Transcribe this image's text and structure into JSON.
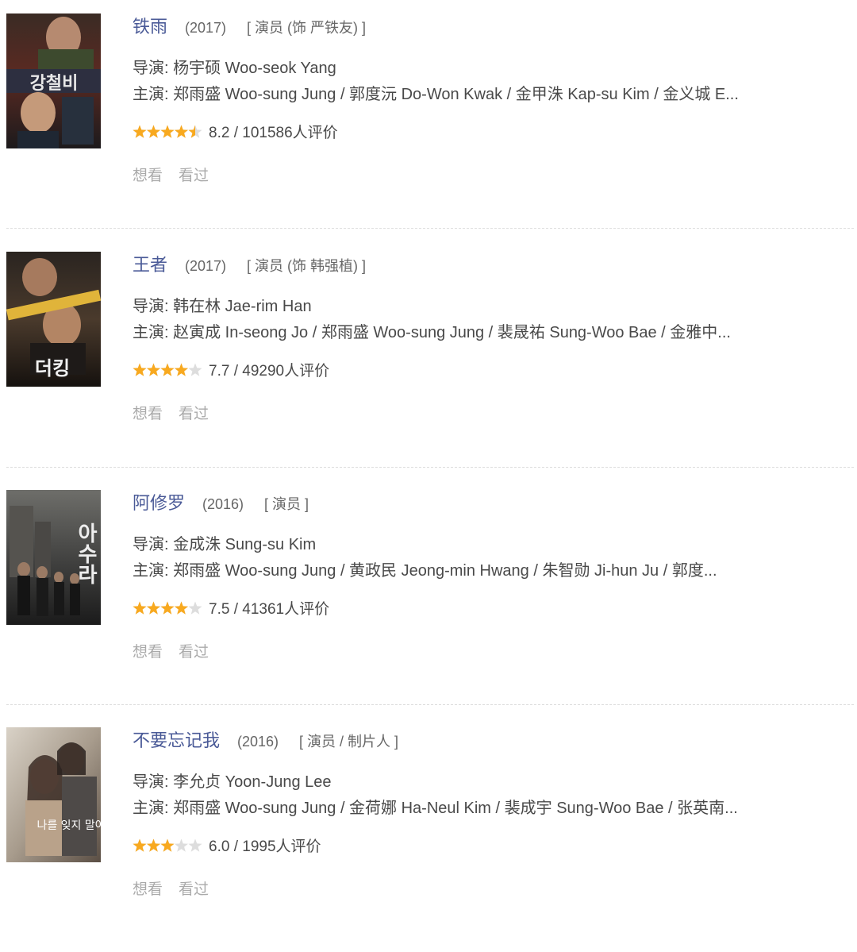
{
  "colors": {
    "title_link": "#4a5a97",
    "text": "#494949",
    "muted": "#666666",
    "action": "#aaaaaa",
    "star_on": "#f8a91f",
    "star_off": "#dddddd"
  },
  "labels": {
    "want": "想看",
    "seen": "看过"
  },
  "movies": [
    {
      "title": "铁雨",
      "year": "(2017)",
      "role": "[ 演员 (饰 严铁友) ]",
      "director": "导演: 杨宇硕 Woo-seok Yang",
      "cast": "主演: 郑雨盛 Woo-sung Jung / 郭度沅 Do-Won Kwak / 金甲洙 Kap-su Kim / 金义城 E...",
      "stars": 4.5,
      "rating_text": "8.2 / 101586人评价",
      "poster_text": "강철비",
      "want": "想看",
      "seen": "看过"
    },
    {
      "title": "王者",
      "year": "(2017)",
      "role": "[ 演员 (饰 韩强植) ]",
      "director": "导演: 韩在林 Jae-rim Han",
      "cast": "主演: 赵寅成 In-seong Jo / 郑雨盛 Woo-sung Jung / 裴晟祐 Sung-Woo Bae / 金雅中...",
      "stars": 4.0,
      "rating_text": "7.7 / 49290人评价",
      "poster_text": "더킹",
      "want": "想看",
      "seen": "看过"
    },
    {
      "title": "阿修罗",
      "year": "(2016)",
      "role": "[ 演员 ]",
      "director": "导演: 金成洙 Sung-su Kim",
      "cast": "主演: 郑雨盛 Woo-sung Jung / 黄政民 Jeong-min Hwang / 朱智勋 Ji-hun Ju / 郭度...",
      "stars": 4.0,
      "rating_text": "7.5 / 41361人评价",
      "poster_text": "아수라",
      "want": "想看",
      "seen": "看过"
    },
    {
      "title": "不要忘记我",
      "year": "(2016)",
      "role": "[ 演员 / 制片人 ]",
      "director": "导演: 李允贞 Yoon-Jung Lee",
      "cast": "主演: 郑雨盛 Woo-sung Jung / 金荷娜 Ha-Neul Kim / 裴成宇 Sung-Woo Bae / 张英南...",
      "stars": 3.0,
      "rating_text": "6.0 / 1995人评价",
      "poster_text": "나를 잊지 말아요",
      "want": "想看",
      "seen": "看过"
    }
  ]
}
